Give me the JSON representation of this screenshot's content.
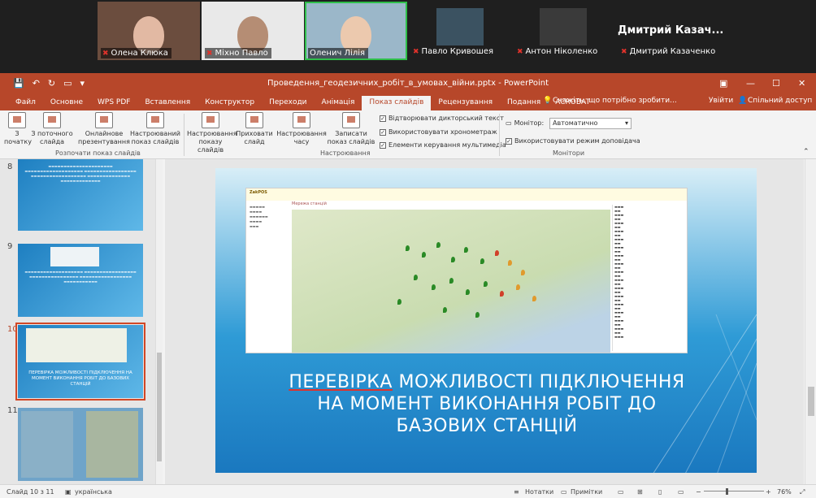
{
  "participants": [
    {
      "name": "Олена Клюка",
      "muted": true
    },
    {
      "name": "Міхно Павло",
      "muted": true
    },
    {
      "name": "Оленич Лілія",
      "muted": false,
      "active": true
    },
    {
      "name": "Павло Кривошея",
      "muted": true
    },
    {
      "name": "Антон Ніколенко",
      "muted": true
    },
    {
      "name": "Дмитрий Казаченко",
      "muted": true
    }
  ],
  "active_speaker_label": "Дмитрий  Казач...",
  "window": {
    "title": "Проведення_геодезичних_робіт_в_умовах_війни.pptx - PowerPoint"
  },
  "tabs": [
    "Файл",
    "Основне",
    "WPS PDF",
    "Вставлення",
    "Конструктор",
    "Переходи",
    "Анімація",
    "Показ слайдів",
    "Рецензування",
    "Подання",
    "ACROBAT"
  ],
  "active_tab": "Показ слайдів",
  "tell_me": "Скажіть, що потрібно зробити...",
  "signin": "Увійти",
  "share": "Спільний доступ",
  "ribbon": {
    "btn_from_start": "З початку",
    "btn_from_current": "З поточного слайда",
    "btn_online": "Онлайнове презентування",
    "btn_custom": "Настроюваний показ слайдів",
    "group_start": "Розпочати показ слайдів",
    "btn_setup": "Настроювання показу слайдів",
    "btn_hide": "Приховати слайд",
    "btn_rehearse": "Настроювання часу",
    "btn_record": "Записати показ слайдів",
    "chk_narration": "Відтворювати дикторський текст",
    "chk_timings": "Використовувати хронометраж",
    "chk_media": "Елементи керування мультимедіа",
    "group_setup": "Настроювання",
    "monitor_label": "Монітор:",
    "monitor_value": "Автоматично",
    "chk_presenter": "Використовувати режим доповідача",
    "group_monitors": "Монітори"
  },
  "thumbs": [
    "8",
    "9",
    "10",
    "11"
  ],
  "current_thumb": "10",
  "thumb10_text": "ПЕРЕВІРКА МОЖЛИВОСТІ ПІДКЛЮЧЕННЯ НА МОМЕНТ ВИКОНАННЯ РОБІТ ДО БАЗОВИХ СТАНЦІЙ",
  "slide": {
    "map_app": "ZakPOS",
    "map_title": "Мережа станцій",
    "title_line1_a": "ПЕРЕВІРКА",
    "title_line1_b": " МОЖЛИВОСТІ ПІДКЛЮЧЕННЯ",
    "title_line2": "НА МОМЕНТ ВИКОНАННЯ РОБІТ ДО",
    "title_line3": "БАЗОВИХ СТАНЦІЙ"
  },
  "status": {
    "slide_of": "Слайд 10 з 11",
    "language": "українська",
    "notes": "Нотатки",
    "comments": "Примітки",
    "zoom": "76%"
  },
  "colors": {
    "accent": "#b7472a",
    "active_speaker": "#2fbf4a"
  }
}
